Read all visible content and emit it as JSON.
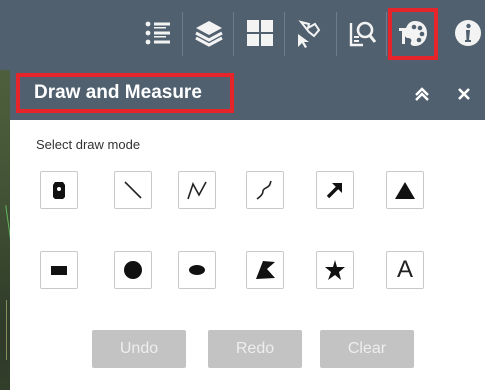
{
  "toolbar": {
    "items": [
      {
        "icon": "list-icon"
      },
      {
        "icon": "layers-icon"
      },
      {
        "icon": "basemap-gallery-icon"
      },
      {
        "icon": "select-icon"
      },
      {
        "icon": "query-icon"
      },
      {
        "icon": "draw-palette-icon",
        "active": true
      },
      {
        "icon": "info-icon"
      }
    ]
  },
  "panel": {
    "title": "Draw and Measure",
    "collapse_icon": "chevron-double-up-icon",
    "close_icon": "close-icon",
    "mode_label": "Select draw mode",
    "modes_row1": [
      {
        "name": "point",
        "icon": "point-icon"
      },
      {
        "name": "line",
        "icon": "line-icon"
      },
      {
        "name": "polyline",
        "icon": "polyline-icon"
      },
      {
        "name": "freehand-polyline",
        "icon": "freehand-polyline-icon"
      },
      {
        "name": "arrow",
        "icon": "arrow-icon"
      },
      {
        "name": "triangle",
        "icon": "triangle-icon"
      }
    ],
    "modes_row2": [
      {
        "name": "rectangle",
        "icon": "rectangle-icon"
      },
      {
        "name": "circle",
        "icon": "circle-icon"
      },
      {
        "name": "ellipse",
        "icon": "ellipse-icon"
      },
      {
        "name": "polygon",
        "icon": "polygon-icon"
      },
      {
        "name": "freehand-polygon",
        "icon": "freehand-polygon-icon"
      },
      {
        "name": "text",
        "icon": "text-icon",
        "text": "A"
      }
    ],
    "actions": {
      "undo": "Undo",
      "redo": "Redo",
      "clear": "Clear"
    }
  },
  "colors": {
    "header": "#50606f",
    "highlight": "#e5252a",
    "disabled_button": "#c3c3c3"
  }
}
